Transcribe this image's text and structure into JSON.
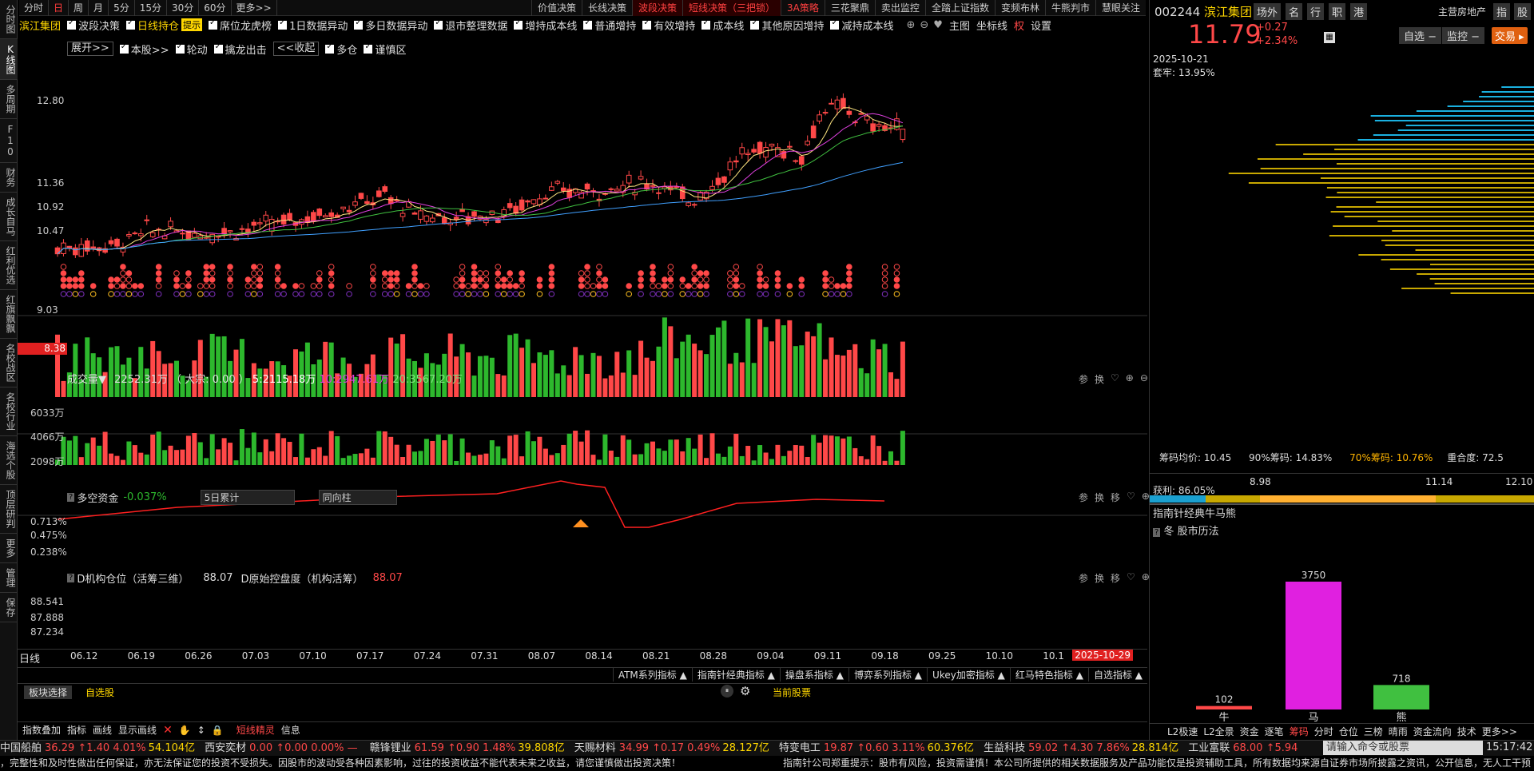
{
  "left_tabs": [
    "分时图",
    "K线图",
    "多周期",
    "F10",
    "财务",
    "成长自马",
    "红利优选",
    "红旗飘飘",
    "名校战区",
    "名校行业",
    "海选个股",
    "顶层研判",
    "更多",
    "管理",
    "保存"
  ],
  "period_tabs": [
    "分时",
    "日",
    "周",
    "月",
    "5分",
    "15分",
    "30分",
    "60分",
    "更多>>"
  ],
  "strategy_tabs": [
    "价值决策",
    "长线决策",
    "波段决策",
    "短线决策（三把锁）",
    "3A策略",
    "三花聚鼎",
    "卖出监控",
    "全踏上证指数",
    "变频布林",
    "牛熊判市",
    "慧眼关注"
  ],
  "stock_name": "滨江集团",
  "indicator_checks": [
    "波段决策",
    "日线持仓",
    "席位龙虎榜",
    "1日数据异动",
    "多日数据异动",
    "退市整理数据",
    "增持成本线",
    "普通增持",
    "有效增持",
    "成本线",
    "其他原因增持",
    "减持成本线"
  ],
  "indicator_tail": [
    "主图",
    "坐标线",
    "权",
    "设置"
  ],
  "tips_label": "提示",
  "row2": {
    "expand": "展开>>",
    "checks": [
      "本股>>",
      "轮动",
      "擒龙出击"
    ],
    "collapse": "<<收起",
    "checks2": [
      "多仓",
      "谨慎区"
    ]
  },
  "main_prices": [
    "12.80",
    "11.36",
    "10.92",
    "10.47",
    "9.03"
  ],
  "current_price_tag": "8.38",
  "volume": {
    "title": "成交量▼",
    "value": "2252.31万",
    "big": "（ 大宗: 0.00 ）",
    "ma5": "5:2115.18万",
    "ma10": "10:2947.61万",
    "ma20": "20:3567.20万",
    "ylabels": [
      "6033万",
      "4066万",
      "2098万"
    ]
  },
  "money": {
    "title": "多空资金",
    "value": "-0.037%",
    "select1": "5日累计",
    "select2": "同向柱",
    "ylabels": [
      "0.713%",
      "0.475%",
      "0.238%"
    ]
  },
  "inst": {
    "title": "D机构仓位（活筹三维）",
    "v1": "88.07",
    "title2": "D原始控盘度（机构活筹）",
    "v2": "88.07",
    "ylabels": [
      "88.541",
      "87.888",
      "87.234"
    ]
  },
  "panel_ctrl": [
    "参",
    "换",
    "移"
  ],
  "dates": [
    "06.12",
    "06.19",
    "06.26",
    "07.03",
    "07.10",
    "07.17",
    "07.24",
    "07.31",
    "08.07",
    "08.14",
    "08.21",
    "08.28",
    "09.04",
    "09.11",
    "09.18",
    "09.25",
    "10.10",
    "10.1"
  ],
  "date_end": "2025-10-29",
  "date_type": "日线",
  "indicator_groups": [
    "ATM系列指标",
    "指南针经典指标",
    "操盘系指标",
    "博弈系列指标",
    "Ukey加密指标",
    "红马特色指标",
    "自选指标"
  ],
  "block_tab": "板块选择",
  "self_tab": "自选股",
  "current_stock": "当前股票",
  "bottom_tools": [
    "指数叠加",
    "指标",
    "画线",
    "显示画线"
  ],
  "short_elf": "短线精灵",
  "info": "信息",
  "right": {
    "code": "002244",
    "name": "滨江集团",
    "tags": [
      "场外",
      "名",
      "行",
      "职",
      "港"
    ],
    "sector": "主营房地产",
    "buttons": [
      "指",
      "股"
    ],
    "price": "11.79",
    "change": "+0.27",
    "pct": "+2.34%",
    "self": "自选",
    "monitor": "监控",
    "trade": "交易",
    "date": "2025-10-21",
    "lock_label": "套牢: 13.95%",
    "chip_avg": "筹码均价: 10.45",
    "chip_90": "90%筹码: 14.83%",
    "chip_70": "70%筹码: 10.76%",
    "overlap": "重合度: 72.5",
    "profit": "获利: 86.05%",
    "p1": "8.98",
    "p2": "11.14",
    "p3": "12.10",
    "bull_title": "指南针经典牛马熊",
    "bull_sub": "冬 股市历法",
    "bars": [
      {
        "label": "牛",
        "value": 102
      },
      {
        "label": "马",
        "value": 3750
      },
      {
        "label": "熊",
        "value": 718
      }
    ],
    "tabs": [
      "L2极速",
      "L2全景",
      "资金",
      "逐笔",
      "筹码",
      "分时",
      "仓位",
      "三榜",
      "晴雨",
      "资金流向",
      "技术",
      "更多>>"
    ],
    "tabs_active": "筹码",
    "cmd_placeholder": "请输入命令或股票",
    "time": "15:17:42"
  },
  "ticker": [
    {
      "n": "中国船舶",
      "v": "36.29 ↑1.40 4.01%",
      "a": "54.104亿"
    },
    {
      "n": "西安奕材",
      "v": "0.00 ↑0.00 0.00% —",
      "a": ""
    },
    {
      "n": "赣锋锂业",
      "v": "61.59 ↑0.90 1.48%",
      "a": "39.808亿"
    },
    {
      "n": "天赐材料",
      "v": "34.99 ↑0.17 0.49%",
      "a": "28.127亿"
    },
    {
      "n": "特变电工",
      "v": "19.87 ↑0.60 3.11%",
      "a": "60.376亿"
    },
    {
      "n": "生益科技",
      "v": "59.02 ↑4.30 7.86%",
      "a": "28.814亿"
    },
    {
      "n": "工业富联",
      "v": "68.00 ↑5.94",
      "a": ""
    }
  ],
  "disclaimer": "，完整性和及时性做出任何保证，亦无法保证您的投资不受损失。因股市的波动受各种因素影响，过往的投资收益不能代表未来之收益，请您谨慎做出投资决策！",
  "disclaimer2": "指南针公司郑重提示：股市有风险，投资需谨慎！本公司所提供的相关数据服务及产品功能仅是投资辅助工具，所有数据均来源自证券市场所披露之资讯，公开信息，无人工干预",
  "colors": {
    "up": "#ff4848",
    "down": "#2db82d",
    "accent": "#ffb400"
  }
}
